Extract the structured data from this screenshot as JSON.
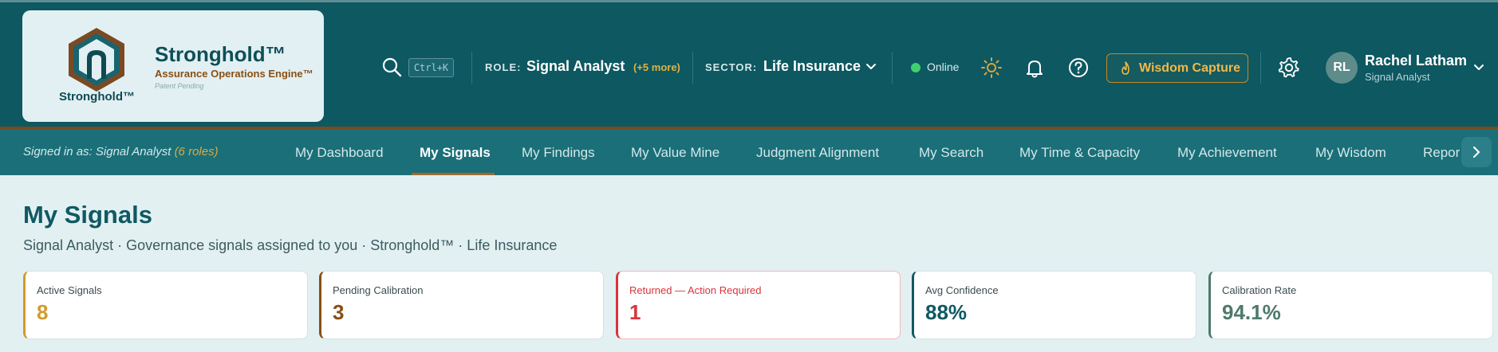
{
  "brand": {
    "logo_word": "Stronghold™",
    "title": "Stronghold™",
    "subtitle": "Assurance Operations Engine™",
    "patent": "Patent Pending"
  },
  "header": {
    "search_shortcut": "Ctrl+K",
    "role_label": "ROLE:",
    "role_value": "Signal Analyst",
    "role_more": "(+5 more)",
    "sector_label": "SECTOR:",
    "sector_value": "Life Insurance",
    "status": "Online",
    "wisdom_button": "Wisdom Capture",
    "user_initials": "RL",
    "user_name": "Rachel Latham",
    "user_role": "Signal Analyst"
  },
  "nav": {
    "signed_in_prefix": "Signed in as: Signal Analyst",
    "signed_in_roles": "(6 roles)",
    "items": [
      {
        "label": "My Dashboard"
      },
      {
        "label": "My Signals"
      },
      {
        "label": "My Findings"
      },
      {
        "label": "My Value Mine"
      },
      {
        "label": "Judgment Alignment"
      },
      {
        "label": "My Search"
      },
      {
        "label": "My Time & Capacity"
      },
      {
        "label": "My Achievement"
      },
      {
        "label": "My Wisdom"
      },
      {
        "label": "Reports"
      }
    ],
    "active_index": 1
  },
  "main": {
    "title": "My Signals",
    "subtitle": "Signal Analyst · Governance signals assigned to you · Stronghold™ · Life Insurance"
  },
  "stats": [
    {
      "label": "Active Signals",
      "value": "8"
    },
    {
      "label": "Pending Calibration",
      "value": "3"
    },
    {
      "label": "Returned — Action Required",
      "value": "1"
    },
    {
      "label": "Avg Confidence",
      "value": "88%"
    },
    {
      "label": "Calibration Rate",
      "value": "94.1%"
    }
  ],
  "colors": {
    "header_bg": "#0d5861",
    "nav_bg": "#1a6f78",
    "accent_gold": "#d29a2c",
    "accent_brown": "#8a4f12",
    "alert_red": "#d9343c",
    "teal_value": "#0f5962",
    "green_value": "#4d7a6c"
  },
  "icons": [
    "search-icon",
    "chevron-down-icon",
    "sun-icon",
    "bell-icon",
    "help-icon",
    "flame-icon",
    "gear-icon",
    "chevron-right-icon",
    "shield-logo-icon"
  ]
}
